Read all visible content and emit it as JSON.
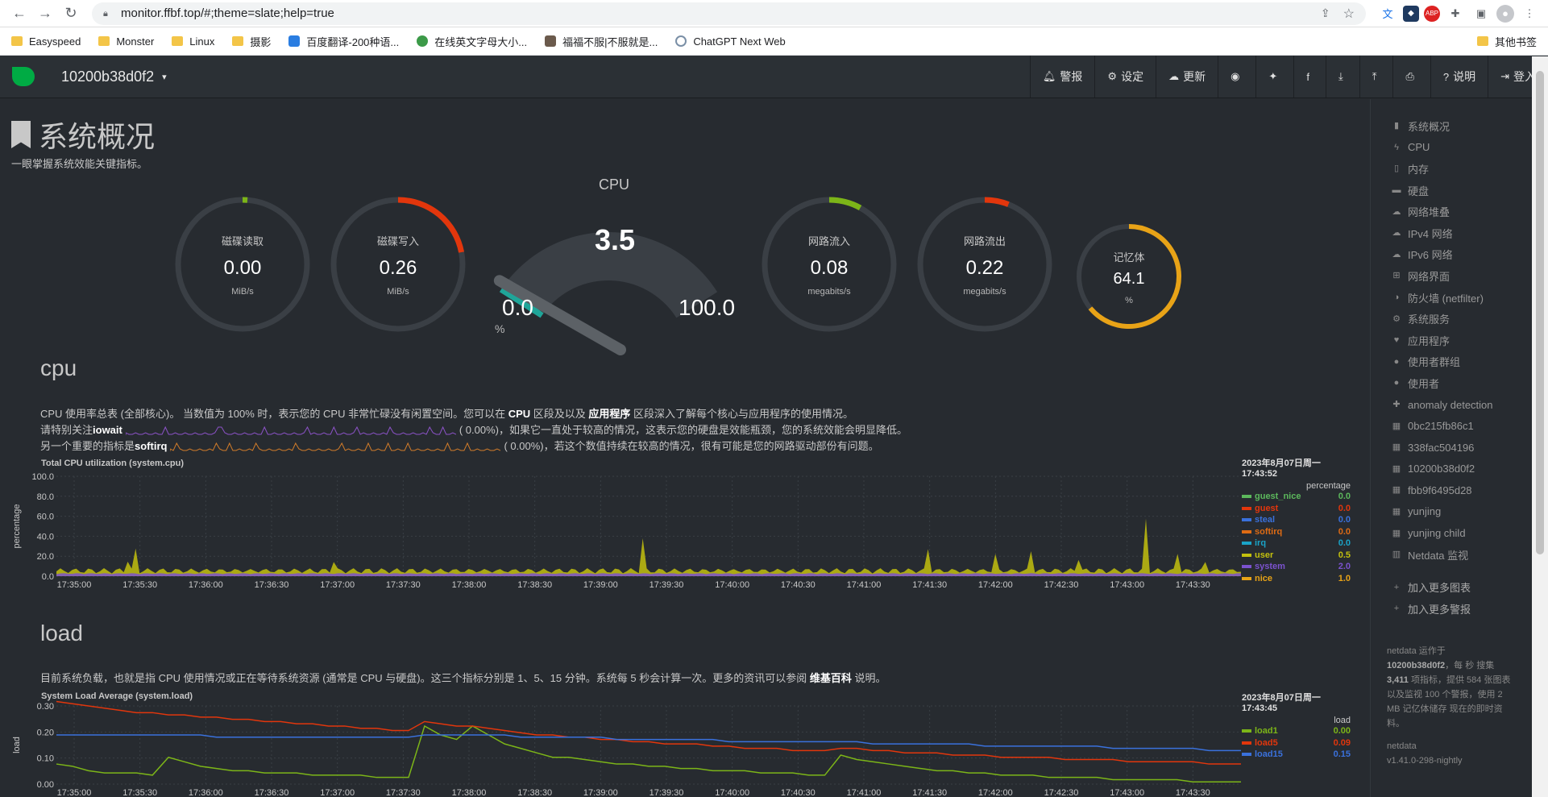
{
  "browser": {
    "url": "monitor.ffbf.top/#;theme=slate;help=true",
    "bookmarks": [
      "Easyspeed",
      "Monster",
      "Linux",
      "摄影",
      "百度翻译-200种语...",
      "在线英文字母大小...",
      "福福不服|不服就是...",
      "ChatGPT Next Web"
    ],
    "other_bookmarks": "其他书签"
  },
  "nav": {
    "hostname": "10200b38d0f2",
    "items": [
      "警报",
      "设定",
      "更新",
      "",
      "",
      "",
      "",
      "",
      "",
      "说明",
      "登入"
    ]
  },
  "page": {
    "title": "系统概况",
    "subtitle": "一眼掌握系统效能关键指标。"
  },
  "gauges": [
    {
      "label": "磁碟读取",
      "value": "0.00",
      "unit": "MiB/s",
      "level": 0.01,
      "color": "#7cb518"
    },
    {
      "label": "磁碟写入",
      "value": "0.26",
      "unit": "MiB/s",
      "level": 0.22,
      "color": "#e2360c"
    },
    {
      "label": "网路流入",
      "value": "0.08",
      "unit": "megabits/s",
      "level": 0.08,
      "color": "#7cb518"
    },
    {
      "label": "网路流出",
      "value": "0.22",
      "unit": "megabits/s",
      "level": 0.06,
      "color": "#e2360c"
    },
    {
      "label": "记忆体",
      "value": "64.1",
      "unit": "%",
      "level": 0.641,
      "color": "#e8a317"
    }
  ],
  "cpu_gauge": {
    "label": "CPU",
    "value": "3.5",
    "min": "0.0",
    "max": "100.0",
    "unit": "%"
  },
  "cpu_section": {
    "title": "cpu",
    "line1_a": "CPU 使用率总表 (全部核心)。 当数值为 100% 时，表示您的 CPU 非常忙碌没有闲置空间。您可以在 ",
    "line1_b": "CPU",
    "line1_c": " 区段及以及 ",
    "line1_d": "应用程序",
    "line1_e": " 区段深入了解每个核心与应用程序的使用情况。",
    "line2_a": "请特别关注 ",
    "line2_b": "iowait",
    "line2_c": "(      0.00%)，如果它一直处于较高的情况，这表示您的硬盘是效能瓶颈，您的系统效能会明显降低。",
    "line3_a": "另一个重要的指标是 ",
    "line3_b": "softirq",
    "line3_c": "(      0.00%)，若这个数值持续在较高的情况，很有可能是您的网路驱动部份有问题。",
    "chart_title": "Total CPU utilization (system.cpu)",
    "ylabel": "percentage",
    "date": "2023年8月07日周一",
    "time": "17:43:52",
    "units": "percentage"
  },
  "load_section": {
    "title": "load",
    "desc_a": "目前系统负载，也就是指 CPU 使用情况或正在等待系统资源 (通常是 CPU 与硬盘)。这三个指标分别是 1、5、15 分钟。系统每 5 秒会计算一次。更多的资讯可以参阅 ",
    "desc_b": "维基百科",
    "desc_c": " 说明。",
    "chart_title": "System Load Average (system.load)",
    "ylabel": "load",
    "date": "2023年8月07日周一",
    "time": "17:43:45",
    "units": "load"
  },
  "chart_data": [
    {
      "type": "area",
      "title": "Total CPU utilization (system.cpu)",
      "ylabel": "percentage",
      "ylim": [
        0,
        100
      ],
      "yticks": [
        "100.0",
        "80.0",
        "60.0",
        "40.0",
        "20.0",
        "0.0"
      ],
      "xticks": [
        "17:35:00",
        "17:35:30",
        "17:36:00",
        "17:36:30",
        "17:37:00",
        "17:37:30",
        "17:38:00",
        "17:38:30",
        "17:39:00",
        "17:39:30",
        "17:40:00",
        "17:40:30",
        "17:41:00",
        "17:41:30",
        "17:42:00",
        "17:42:30",
        "17:43:00",
        "17:43:30"
      ],
      "series": [
        {
          "name": "guest_nice",
          "value": "0.0",
          "color": "#5cb85c"
        },
        {
          "name": "guest",
          "value": "0.0",
          "color": "#e2360c"
        },
        {
          "name": "steal",
          "value": "0.0",
          "color": "#3a71dc"
        },
        {
          "name": "softirq",
          "value": "0.0",
          "color": "#de6b14"
        },
        {
          "name": "irq",
          "value": "0.0",
          "color": "#1aa3c7"
        },
        {
          "name": "user",
          "value": "0.5",
          "color": "#c3c00e"
        },
        {
          "name": "system",
          "value": "2.0",
          "color": "#7b52ce"
        },
        {
          "name": "nice",
          "value": "1.0",
          "color": "#e8a317"
        }
      ]
    },
    {
      "type": "line",
      "title": "System Load Average (system.load)",
      "ylabel": "load",
      "ylim": [
        0,
        0.35
      ],
      "yticks": [
        "0.30",
        "0.20",
        "0.10",
        "0.00"
      ],
      "xticks": [
        "17:35:00",
        "17:35:30",
        "17:36:00",
        "17:36:30",
        "17:37:00",
        "17:37:30",
        "17:38:00",
        "17:38:30",
        "17:39:00",
        "17:39:30",
        "17:40:00",
        "17:40:30",
        "17:41:00",
        "17:41:30",
        "17:42:00",
        "17:42:30",
        "17:43:00",
        "17:43:30"
      ],
      "series": [
        {
          "name": "load1",
          "value": "0.00",
          "color": "#7cb518",
          "points": [
            0.09,
            0.08,
            0.06,
            0.05,
            0.05,
            0.05,
            0.04,
            0.12,
            0.1,
            0.08,
            0.07,
            0.06,
            0.06,
            0.05,
            0.05,
            0.05,
            0.04,
            0.04,
            0.04,
            0.04,
            0.03,
            0.03,
            0.03,
            0.26,
            0.22,
            0.2,
            0.26,
            0.22,
            0.18,
            0.16,
            0.14,
            0.12,
            0.12,
            0.11,
            0.1,
            0.09,
            0.09,
            0.08,
            0.08,
            0.07,
            0.07,
            0.06,
            0.06,
            0.06,
            0.05,
            0.05,
            0.05,
            0.04,
            0.04,
            0.13,
            0.11,
            0.1,
            0.09,
            0.08,
            0.07,
            0.06,
            0.06,
            0.05,
            0.05,
            0.04,
            0.04,
            0.04,
            0.03,
            0.03,
            0.03,
            0.03,
            0.02,
            0.02,
            0.02,
            0.02,
            0.02,
            0.01,
            0.01,
            0.01,
            0.01
          ]
        },
        {
          "name": "load5",
          "value": "0.09",
          "color": "#e2360c",
          "points": [
            0.37,
            0.36,
            0.35,
            0.34,
            0.33,
            0.32,
            0.32,
            0.31,
            0.31,
            0.3,
            0.3,
            0.29,
            0.29,
            0.28,
            0.28,
            0.27,
            0.27,
            0.26,
            0.26,
            0.25,
            0.25,
            0.24,
            0.24,
            0.28,
            0.27,
            0.26,
            0.26,
            0.25,
            0.24,
            0.23,
            0.22,
            0.22,
            0.21,
            0.21,
            0.2,
            0.2,
            0.19,
            0.19,
            0.18,
            0.18,
            0.18,
            0.17,
            0.17,
            0.16,
            0.16,
            0.16,
            0.15,
            0.15,
            0.15,
            0.16,
            0.16,
            0.15,
            0.15,
            0.14,
            0.14,
            0.14,
            0.13,
            0.13,
            0.13,
            0.12,
            0.12,
            0.12,
            0.12,
            0.11,
            0.11,
            0.11,
            0.11,
            0.1,
            0.1,
            0.1,
            0.1,
            0.1,
            0.09,
            0.09,
            0.09
          ]
        },
        {
          "name": "load15",
          "value": "0.15",
          "color": "#3a71dc",
          "points": [
            0.22,
            0.22,
            0.22,
            0.22,
            0.22,
            0.22,
            0.22,
            0.22,
            0.22,
            0.22,
            0.21,
            0.21,
            0.21,
            0.21,
            0.21,
            0.21,
            0.21,
            0.21,
            0.21,
            0.21,
            0.21,
            0.21,
            0.21,
            0.22,
            0.22,
            0.22,
            0.22,
            0.22,
            0.22,
            0.21,
            0.21,
            0.21,
            0.21,
            0.21,
            0.21,
            0.2,
            0.2,
            0.2,
            0.2,
            0.2,
            0.2,
            0.2,
            0.19,
            0.19,
            0.19,
            0.19,
            0.19,
            0.19,
            0.19,
            0.19,
            0.19,
            0.18,
            0.18,
            0.18,
            0.18,
            0.18,
            0.18,
            0.18,
            0.17,
            0.17,
            0.17,
            0.17,
            0.17,
            0.17,
            0.17,
            0.17,
            0.16,
            0.16,
            0.16,
            0.16,
            0.16,
            0.16,
            0.15,
            0.15,
            0.15
          ]
        }
      ]
    }
  ],
  "sidebar": {
    "items": [
      {
        "label": "系统概况",
        "icon": "bookmark-icon",
        "glyph": "▮"
      },
      {
        "label": "CPU",
        "icon": "bolt-icon",
        "glyph": "ϟ"
      },
      {
        "label": "内存",
        "icon": "memory-icon",
        "glyph": "▯"
      },
      {
        "label": "硬盘",
        "icon": "hdd-icon",
        "glyph": "▬"
      },
      {
        "label": "网络堆叠",
        "icon": "cloud-icon",
        "glyph": "☁"
      },
      {
        "label": "IPv4 网络",
        "icon": "cloud-icon",
        "glyph": "☁"
      },
      {
        "label": "IPv6 网络",
        "icon": "cloud-icon",
        "glyph": "☁"
      },
      {
        "label": "网络界面",
        "icon": "sitemap-icon",
        "glyph": "⊞"
      },
      {
        "label": "防火墙 (netfilter)",
        "icon": "shield-icon",
        "glyph": "◑"
      },
      {
        "label": "系统服务",
        "icon": "cogs-icon",
        "glyph": "⚙"
      },
      {
        "label": "应用程序",
        "icon": "heartbeat-icon",
        "glyph": "♥"
      },
      {
        "label": "使用者群组",
        "icon": "users-icon",
        "glyph": "●"
      },
      {
        "label": "使用者",
        "icon": "user-icon",
        "glyph": "●"
      },
      {
        "label": "anomaly detection",
        "icon": "puzzle-icon",
        "glyph": "✚"
      },
      {
        "label": "0bc215fb86c1",
        "icon": "th-icon",
        "glyph": "▦"
      },
      {
        "label": "338fac504196",
        "icon": "th-icon",
        "glyph": "▦"
      },
      {
        "label": "10200b38d0f2",
        "icon": "th-icon",
        "glyph": "▦"
      },
      {
        "label": "fbb9f6495d28",
        "icon": "th-icon",
        "glyph": "▦"
      },
      {
        "label": "yunjing",
        "icon": "th-icon",
        "glyph": "▦"
      },
      {
        "label": "yunjing child",
        "icon": "th-icon",
        "glyph": "▦"
      },
      {
        "label": "Netdata 监视",
        "icon": "chart-icon",
        "glyph": "▥"
      }
    ],
    "add_chart": "加入更多图表",
    "add_alarm": "加入更多警报",
    "foot_a": "netdata 运作于",
    "foot_host": "10200b38d0f2",
    "foot_b": "，每 秒 搜集",
    "foot_metrics": "3,411",
    "foot_c": " 项指标，提供 584 张图表以及监视 100 个警报，使用 2 MB 记亿体储存 现在的即时资料。",
    "foot_name": "netdata",
    "foot_version": "v1.41.0-298-nightly"
  }
}
